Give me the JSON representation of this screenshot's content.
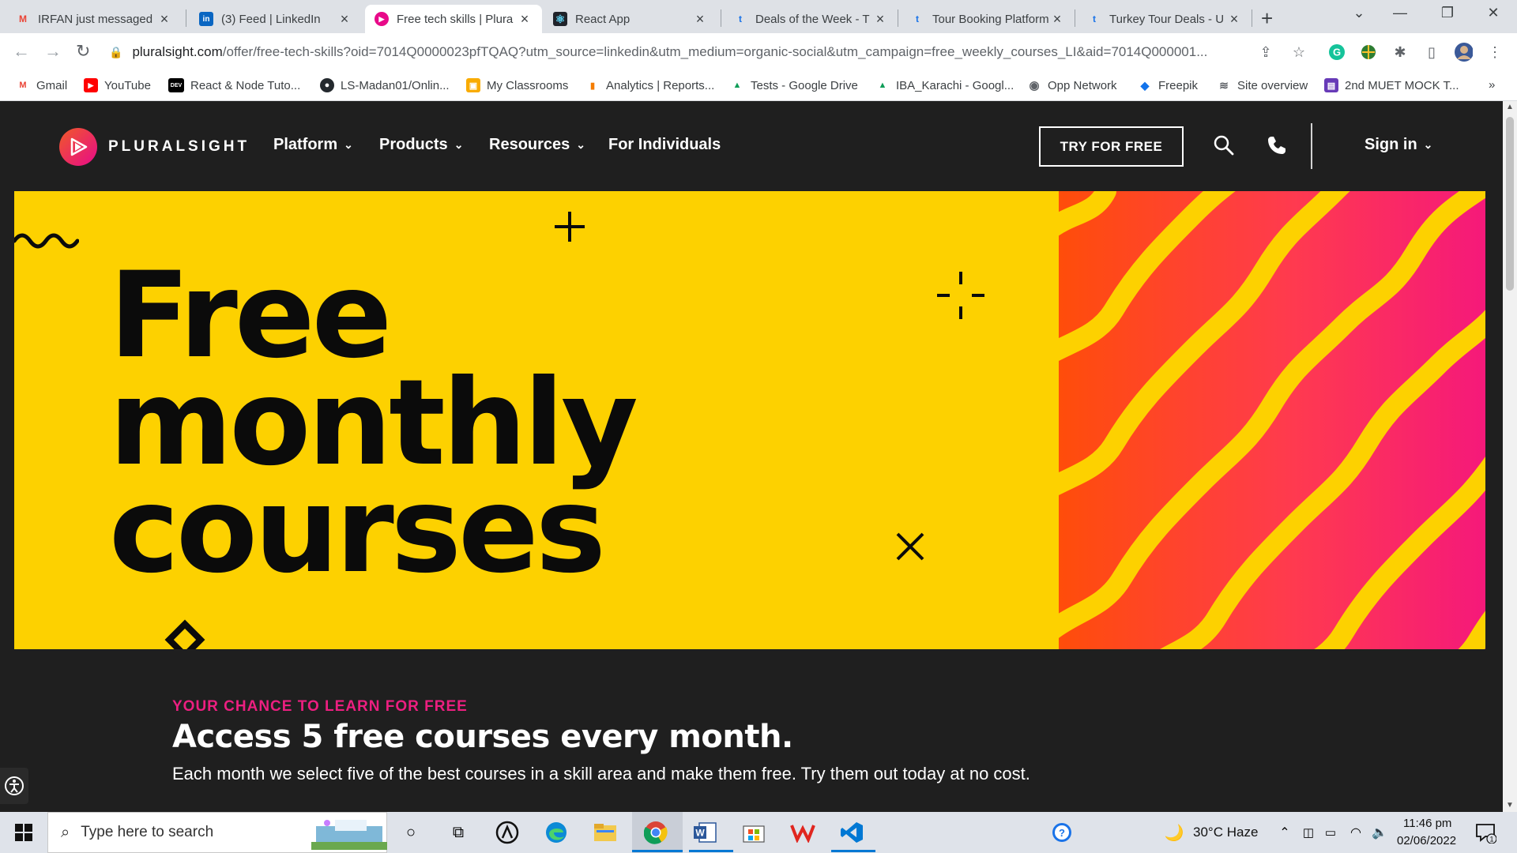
{
  "browser": {
    "tabs": [
      {
        "title": "IRFAN just messaged",
        "icon": "gmail-icon",
        "favicon_text": "M",
        "color": "#ea4335"
      },
      {
        "title": "(3) Feed | LinkedIn",
        "icon": "linkedin-icon",
        "favicon_text": "in",
        "color": "#0a66c2"
      },
      {
        "title": "Free tech skills | Plura",
        "icon": "pluralsight-icon",
        "favicon_text": "▶",
        "color": "#e80a89",
        "active": true
      },
      {
        "title": "React App",
        "icon": "react-icon",
        "favicon_text": "⚛",
        "color": "#61dafb"
      },
      {
        "title": "Deals of the Week - T",
        "icon": "trip-icon",
        "favicon_text": "t",
        "color": "#1a73e8"
      },
      {
        "title": "Tour Booking Platform",
        "icon": "trip-icon",
        "favicon_text": "t",
        "color": "#1a73e8"
      },
      {
        "title": "Turkey Tour Deals - U",
        "icon": "trip-icon",
        "favicon_text": "t",
        "color": "#1a73e8"
      }
    ],
    "url_host": "pluralsight.com",
    "url_rest": "/offer/free-tech-skills?oid=7014Q0000023pfTQAQ?utm_source=linkedin&utm_medium=organic-social&utm_campaign=free_weekly_courses_LI&aid=7014Q000001...",
    "bookmarks": [
      {
        "label": "Gmail",
        "icon": "gmail-icon",
        "glyph": "M",
        "color": "#ea4335"
      },
      {
        "label": "YouTube",
        "icon": "youtube-icon",
        "glyph": "▶",
        "color": "#ff0000"
      },
      {
        "label": "React & Node Tuto...",
        "icon": "dev-icon",
        "glyph": "DEV",
        "color": "#000000"
      },
      {
        "label": "LS-Madan01/Onlin...",
        "icon": "github-icon",
        "glyph": "●",
        "color": "#24292e"
      },
      {
        "label": "My Classrooms",
        "icon": "classroom-icon",
        "glyph": "▣",
        "color": "#f9ab00"
      },
      {
        "label": "Analytics | Reports...",
        "icon": "analytics-icon",
        "glyph": "▮",
        "color": "#f57c00"
      },
      {
        "label": "Tests - Google Drive",
        "icon": "drive-icon",
        "glyph": "▲",
        "color": "#0f9d58"
      },
      {
        "label": "IBA_Karachi - Googl...",
        "icon": "drive-icon",
        "glyph": "▲",
        "color": "#0f9d58"
      },
      {
        "label": "Opp Network",
        "icon": "globe-icon",
        "glyph": "◉",
        "color": "#5f6368"
      },
      {
        "label": "Freepik",
        "icon": "freepik-icon",
        "glyph": "◆",
        "color": "#1273eb"
      },
      {
        "label": "Site overview",
        "icon": "site-icon",
        "glyph": "≋",
        "color": "#5f6368"
      },
      {
        "label": "2nd MUET MOCK T...",
        "icon": "forms-icon",
        "glyph": "▤",
        "color": "#673ab7"
      }
    ],
    "more_bookmarks": "»"
  },
  "site": {
    "logo_text": "PLURALSIGHT",
    "menu": [
      "Platform",
      "Products",
      "Resources",
      "For Individuals"
    ],
    "try_button": "TRY FOR FREE",
    "signin": "Sign in"
  },
  "hero": {
    "title_lines": [
      "Free",
      "monthly",
      "courses"
    ]
  },
  "intro": {
    "eyebrow": "YOUR CHANCE TO LEARN FOR FREE",
    "headline": "Access 5 free courses every month.",
    "body": "Each month we select five of the best courses in a skill area and make them free. Try them out today at no cost."
  },
  "taskbar": {
    "search_placeholder": "Type here to search",
    "weather": "30°C  Haze",
    "time": "11:46 pm",
    "date": "02/06/2022",
    "notifications": "1"
  },
  "colors": {
    "hero_yellow": "#fdd100",
    "accent_pink": "#ec1f80",
    "nav_bg": "#1f1f1f"
  }
}
